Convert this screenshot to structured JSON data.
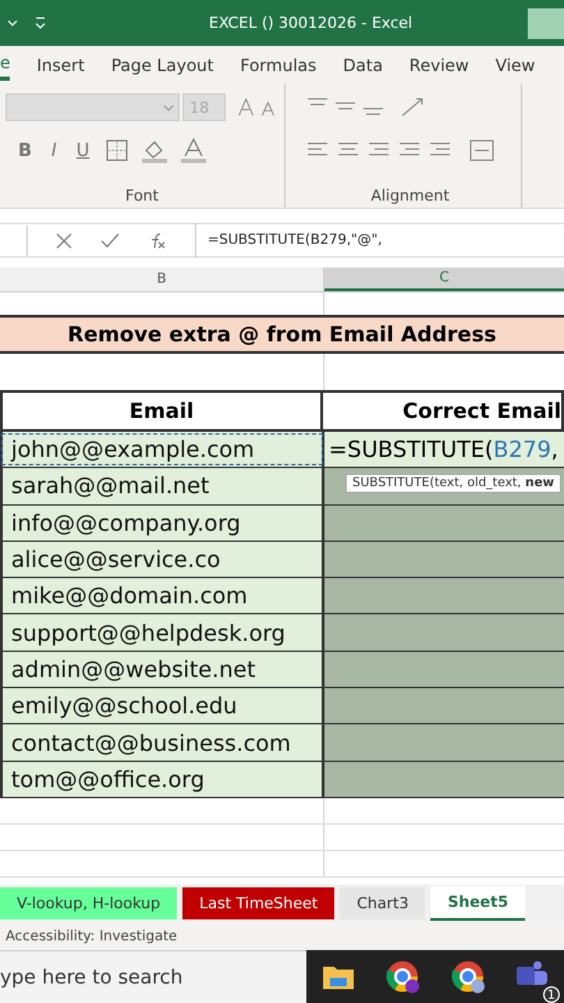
{
  "window": {
    "title": "EXCEL () 30012026  -  Excel"
  },
  "ribbon_tabs": [
    {
      "label": "e",
      "selected": true
    },
    {
      "label": "Insert",
      "selected": false
    },
    {
      "label": "Page Layout",
      "selected": false
    },
    {
      "label": "Formulas",
      "selected": false
    },
    {
      "label": "Data",
      "selected": false
    },
    {
      "label": "Review",
      "selected": false
    },
    {
      "label": "View",
      "selected": false
    }
  ],
  "font_group": {
    "size": "18",
    "style_buttons": [
      "B",
      "I",
      "U"
    ],
    "label": "Font"
  },
  "alignment_group": {
    "label": "Alignment"
  },
  "formula_bar": {
    "formula": "=SUBSTITUTE(B279,\"@\","
  },
  "columns": [
    {
      "label": "B",
      "selected": false
    },
    {
      "label": "C",
      "selected": true
    }
  ],
  "sheet": {
    "title": "Remove extra @ from Email Address",
    "headers": [
      "Email",
      "Correct Email"
    ],
    "rows": [
      {
        "email": "john@@example.com",
        "result": "=SUBSTITUTE(",
        "ref": "B279",
        "tail": ","
      },
      {
        "email": "sarah@@mail.net"
      },
      {
        "email": "info@@company.org"
      },
      {
        "email": "alice@@service.co"
      },
      {
        "email": "mike@@domain.com"
      },
      {
        "email": "support@@helpdesk.org"
      },
      {
        "email": "admin@@website.net"
      },
      {
        "email": "emily@@school.edu"
      },
      {
        "email": "contact@@business.com"
      },
      {
        "email": "tom@@office.org"
      }
    ],
    "tooltip": "SUBSTITUTE(text, old_text, **new**"
  },
  "sheet_tabs": [
    {
      "label": "V-lookup, H-lookup",
      "selected": false,
      "color": "#66ff99"
    },
    {
      "label": "Last TimeSheet",
      "selected": false,
      "color": "#c00000"
    },
    {
      "label": "Chart3",
      "selected": false,
      "color": "#e6e6e6"
    },
    {
      "label": "Sheet5",
      "selected": true,
      "color": "#ffffff"
    }
  ],
  "status_bar": {
    "text": "Accessibility: Investigate"
  },
  "taskbar": {
    "search_placeholder": "ype here to search",
    "badge": "1"
  }
}
